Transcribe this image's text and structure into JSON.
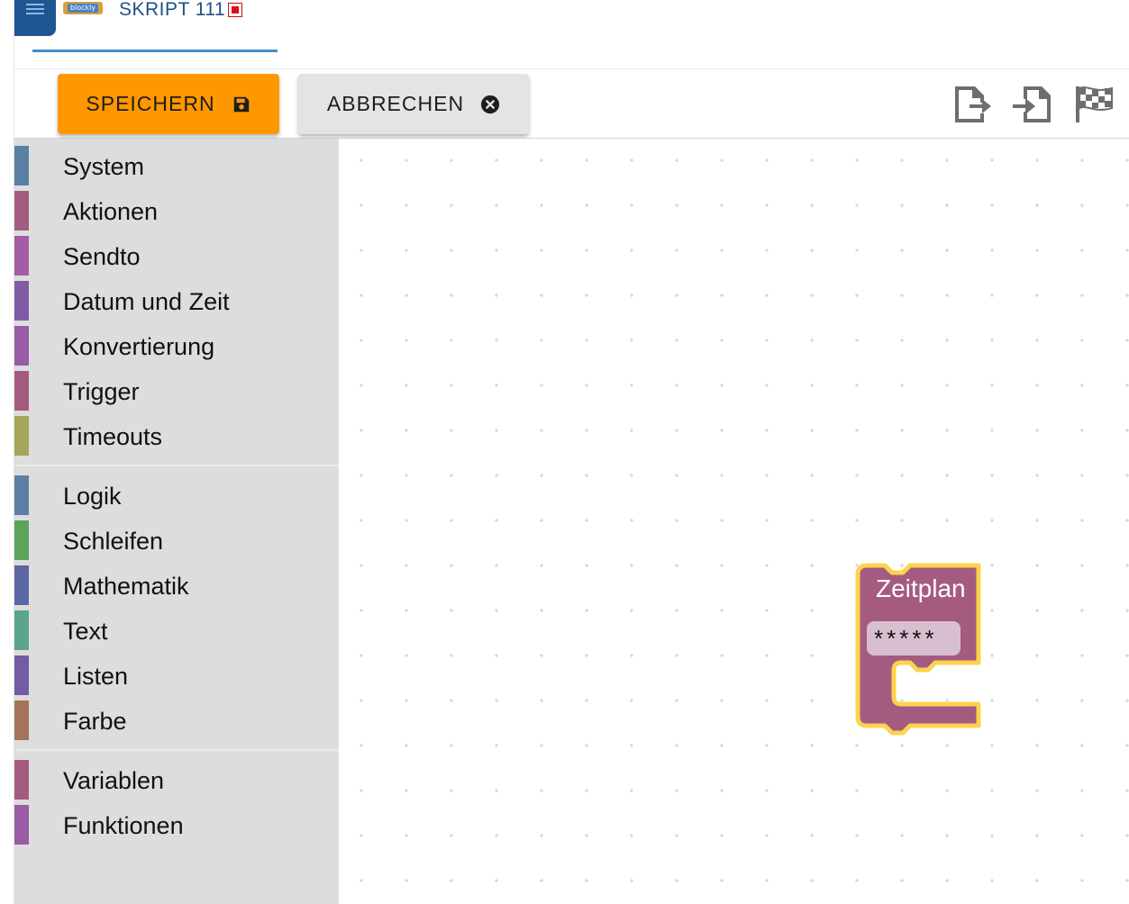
{
  "header": {
    "logo_text": "blockly",
    "tab_title": "SKRIPT 111"
  },
  "toolbar": {
    "save_label": "SPEICHERN",
    "cancel_label": "ABBRECHEN",
    "icons": [
      "export-icon",
      "import-icon",
      "checkered-flag-icon"
    ]
  },
  "toolbox": {
    "groups": [
      [
        {
          "label": "System",
          "color": "#5b80a5"
        },
        {
          "label": "Aktionen",
          "color": "#a55b80"
        },
        {
          "label": "Sendto",
          "color": "#a55ba5"
        },
        {
          "label": "Datum und Zeit",
          "color": "#805ba5"
        },
        {
          "label": "Konvertierung",
          "color": "#995ba5"
        },
        {
          "label": "Trigger",
          "color": "#a55b80"
        },
        {
          "label": "Timeouts",
          "color": "#a5a55b"
        }
      ],
      [
        {
          "label": "Logik",
          "color": "#5b80a5"
        },
        {
          "label": "Schleifen",
          "color": "#5ba55b"
        },
        {
          "label": "Mathematik",
          "color": "#5b67a5"
        },
        {
          "label": "Text",
          "color": "#5ba58c"
        },
        {
          "label": "Listen",
          "color": "#745ba5"
        },
        {
          "label": "Farbe",
          "color": "#a5745b"
        }
      ],
      [
        {
          "label": "Variablen",
          "color": "#a55b80"
        },
        {
          "label": "Funktionen",
          "color": "#995ba5"
        }
      ]
    ]
  },
  "block": {
    "title": "Zeitplan",
    "field_value": "*****",
    "color": "#a55b80",
    "highlight_color": "#fcd34d"
  },
  "colors": {
    "accent": "#ff9800",
    "tab_underline": "#3d8fcd",
    "menu_button": "#1f5593"
  }
}
